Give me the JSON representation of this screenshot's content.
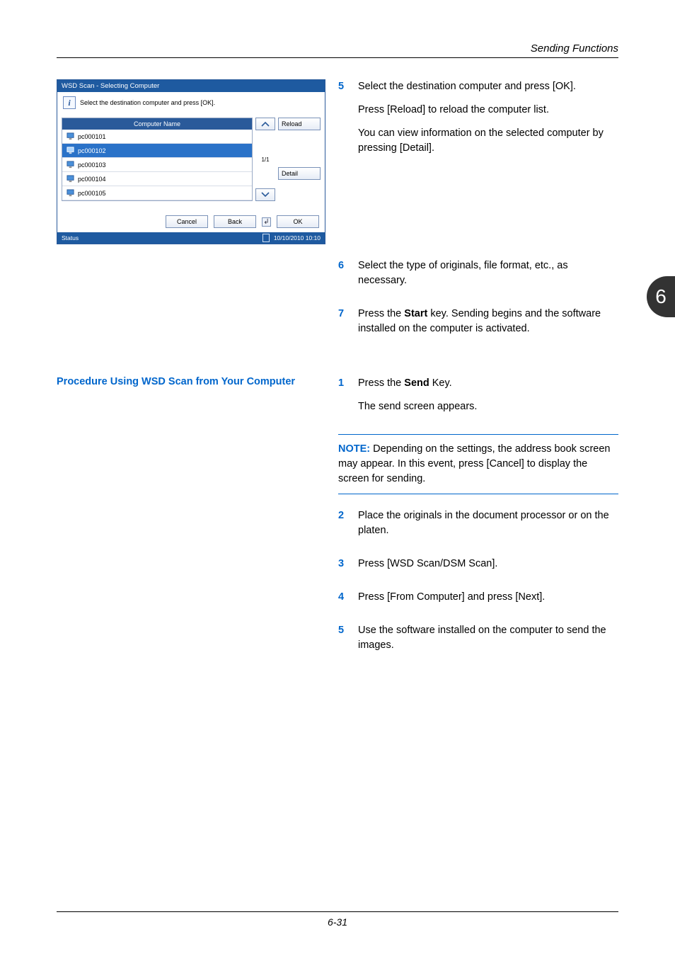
{
  "header": {
    "section_title": "Sending Functions"
  },
  "chapter_tab": "6",
  "dialog": {
    "title": "WSD Scan - Selecting Computer",
    "instruction": "Select the destination computer and press [OK].",
    "list_header": "Computer Name",
    "rows": [
      {
        "name": "pc000101",
        "selected": false
      },
      {
        "name": "pc000102",
        "selected": true
      },
      {
        "name": "pc000103",
        "selected": false
      },
      {
        "name": "pc000104",
        "selected": false
      },
      {
        "name": "pc000105",
        "selected": false
      }
    ],
    "page_indicator": "1/1",
    "side_buttons": {
      "reload": "Reload",
      "detail": "Detail"
    },
    "actions": {
      "cancel": "Cancel",
      "back": "Back",
      "ok": "OK"
    },
    "status_label": "Status",
    "timestamp": "10/10/2010   10:10"
  },
  "block1": {
    "step5": {
      "num": "5",
      "p1": "Select the destination computer and press [OK].",
      "p2": "Press [Reload] to reload the computer list.",
      "p3": "You can view information on the selected computer by pressing [Detail]."
    },
    "step6": {
      "num": "6",
      "text": "Select the type of originals, file format, etc., as necessary."
    },
    "step7": {
      "num": "7",
      "text_pre": "Press the ",
      "bold": "Start",
      "text_post": " key. Sending begins and the software installed on the computer is activated."
    }
  },
  "sub_heading": "Procedure Using WSD Scan from Your Computer",
  "block2": {
    "step1": {
      "num": "1",
      "text_pre": "Press the ",
      "bold": "Send",
      "text_post": " Key.",
      "p2": "The send screen appears."
    },
    "note": {
      "label": "NOTE:",
      "text": " Depending on the settings, the address book screen may appear. In this event, press [Cancel] to display the screen for sending."
    },
    "step2": {
      "num": "2",
      "text": "Place the originals in the document processor or on the platen."
    },
    "step3": {
      "num": "3",
      "text": "Press [WSD Scan/DSM Scan]."
    },
    "step4": {
      "num": "4",
      "text": "Press [From Computer] and press [Next]."
    },
    "step5": {
      "num": "5",
      "text": "Use the software installed on the computer to send the images."
    }
  },
  "footer": {
    "page": "6-31"
  }
}
